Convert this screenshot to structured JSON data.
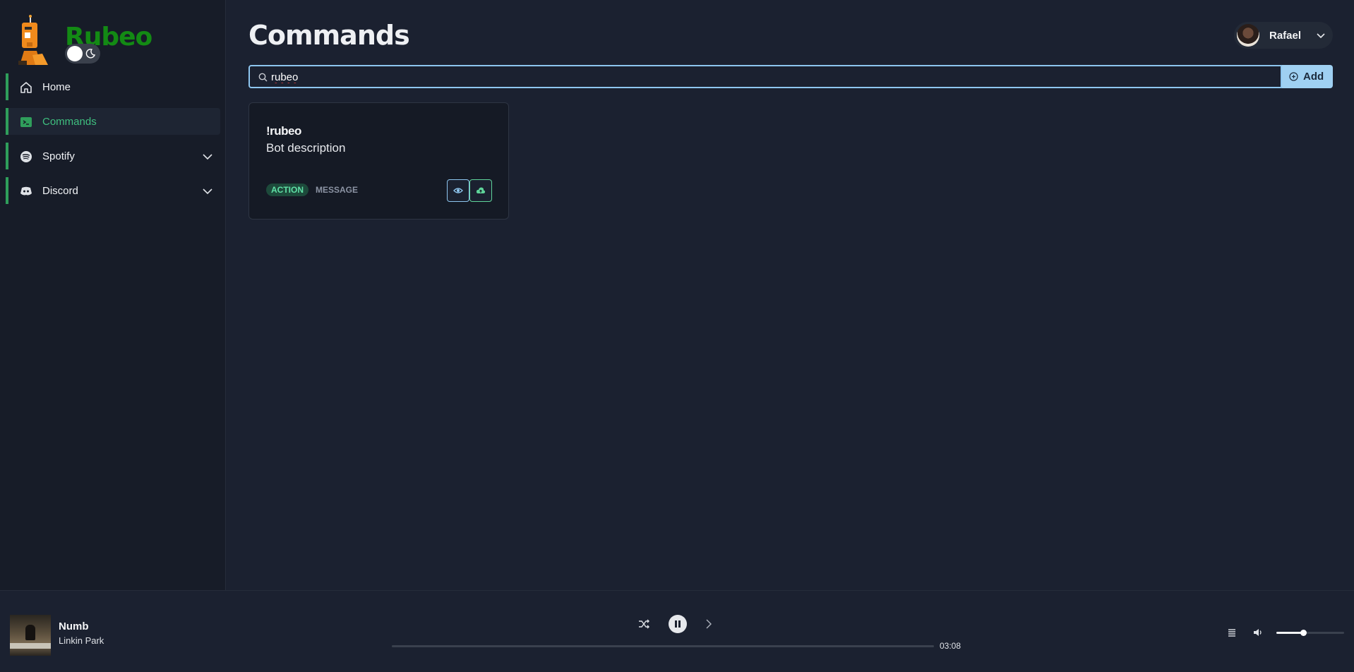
{
  "brand": {
    "name": "Rubeo",
    "accent": "#138a14"
  },
  "sidebar": {
    "items": [
      {
        "label": "Home",
        "icon": "home-icon",
        "active": false,
        "expandable": false
      },
      {
        "label": "Commands",
        "icon": "terminal-icon",
        "active": true,
        "expandable": false
      },
      {
        "label": "Spotify",
        "icon": "spotify-icon",
        "active": false,
        "expandable": true
      },
      {
        "label": "Discord",
        "icon": "discord-icon",
        "active": false,
        "expandable": true
      }
    ]
  },
  "header": {
    "title": "Commands",
    "user": {
      "name": "Rafael"
    }
  },
  "search": {
    "value": "rubeo",
    "add_label": "Add"
  },
  "commands": [
    {
      "name": "!rubeo",
      "description": "Bot description",
      "type_badge": "ACTION",
      "kind_badge": "MESSAGE"
    }
  ],
  "player": {
    "title": "Numb",
    "artist": "Linkin Park",
    "duration": "03:08",
    "progress": 0.0,
    "volume": 0.4
  },
  "colors": {
    "background": "#1b2130",
    "sidebar": "#171c28",
    "nav_indicator": "#2f9e5b",
    "active_text": "#3fbf7f",
    "search_border": "#8ec6ef",
    "add_button": "#9fd0f2"
  }
}
